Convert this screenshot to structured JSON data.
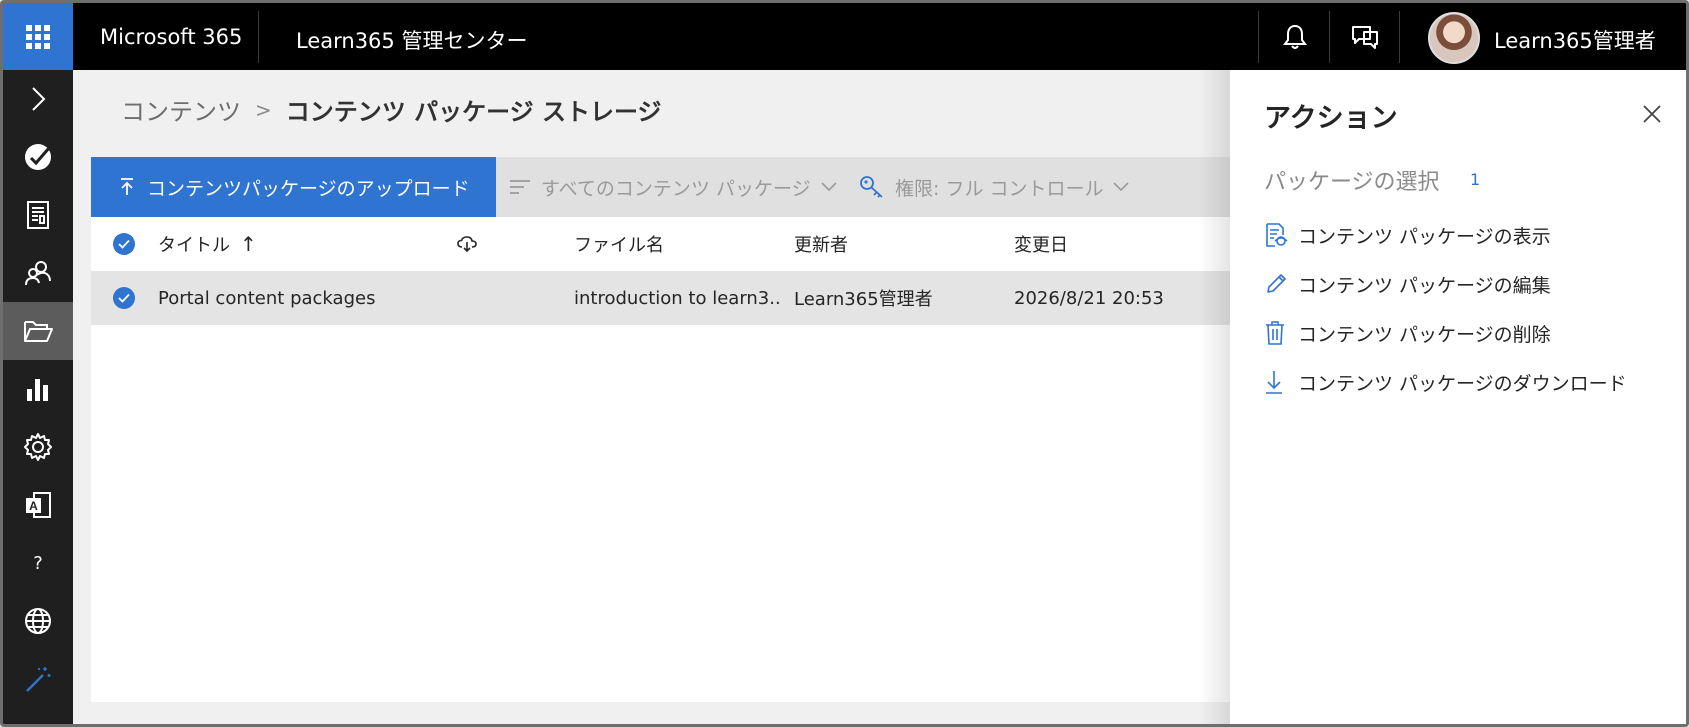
{
  "topbar": {
    "brand": "Microsoft 365",
    "app_title": "Learn365 管理センター",
    "username": "Learn365管理者",
    "icons": [
      "waffle-icon",
      "bell-icon",
      "feedback-icon"
    ]
  },
  "rail": {
    "icons": [
      "chevron-right-icon",
      "dashboard-icon",
      "report-icon",
      "users-icon",
      "folder-open-icon",
      "analytics-icon",
      "settings-icon",
      "language-icon",
      "help-icon",
      "globe-icon",
      "magic-wand-icon"
    ],
    "help_text": "?"
  },
  "breadcrumb": {
    "parent": "コンテンツ",
    "current": "コンテンツ パッケージ ストレージ"
  },
  "commands": {
    "upload": "コンテンツパッケージのアップロード",
    "filter": "すべてのコンテンツ パッケージ",
    "permission": "権限: フル コントロール"
  },
  "table": {
    "columns": {
      "title": "タイトル",
      "sort_indicator": "↑",
      "filename": "ファイル名",
      "modified_by": "更新者",
      "modified_date": "変更日"
    },
    "rows": [
      {
        "title": "Portal content packages",
        "filename": "introduction to learn3...",
        "modified_by": "Learn365管理者",
        "modified_date": "2026/8/21 20:53"
      }
    ]
  },
  "panel": {
    "title": "アクション",
    "selection_label": "パッケージの選択",
    "selection_count": "1",
    "actions": [
      {
        "label": "コンテンツ パッケージの表示",
        "icon": "view-icon"
      },
      {
        "label": "コンテンツ パッケージの編集",
        "icon": "edit-icon"
      },
      {
        "label": "コンテンツ パッケージの削除",
        "icon": "delete-icon"
      },
      {
        "label": "コンテンツ パッケージのダウンロード",
        "icon": "download-icon"
      }
    ]
  },
  "colors": {
    "accent": "#2f74d0",
    "topbar": "#000000",
    "rail": "#1f1f1f",
    "rail_active": "#5c5c5c"
  }
}
